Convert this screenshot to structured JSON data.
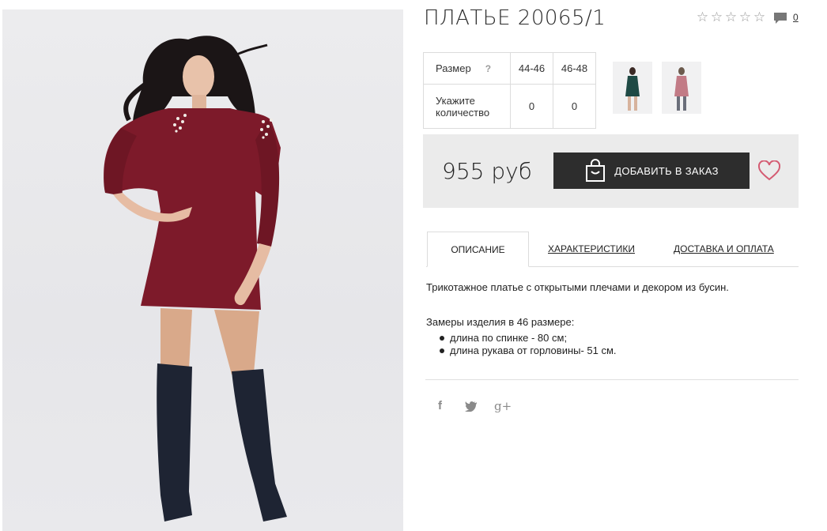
{
  "product": {
    "title": "ПЛАТЬЕ 20065/1",
    "rating_stars": [
      "☆",
      "☆",
      "☆",
      "☆",
      "☆"
    ],
    "comment_count": "0",
    "comment_icon": "speech-bubble-icon"
  },
  "sizes": {
    "size_label": "Размер",
    "help_mark": "?",
    "quantity_label": "Укажите количество",
    "columns": [
      "44-46",
      "46-48"
    ],
    "quantities": [
      "0",
      "0"
    ]
  },
  "thumbnails": [
    {
      "name": "thumbnail-green-dress",
      "color": "#1f4a45"
    },
    {
      "name": "thumbnail-pink-dress",
      "color": "#c27b86"
    }
  ],
  "buy": {
    "price": "955 руб",
    "add_label": "ДОБАВИТЬ В ЗАКАЗ",
    "bag_icon": "shopping-bag-icon",
    "wishlist_icon": "heart-icon"
  },
  "tabs": [
    {
      "label": "ОПИСАНИЕ",
      "active": true
    },
    {
      "label": "ХАРАКТЕРИСТИКИ",
      "active": false
    },
    {
      "label": "ДОСТАВКА И ОПЛАТА",
      "active": false
    }
  ],
  "description": {
    "text": "Трикотажное платье с открытыми плечами и декором из бусин.",
    "measures_title": "Замеры изделия в 46 размере:",
    "measures": [
      "длина по спинке - 80 см;",
      "длина рукава от горловины- 51 см."
    ]
  },
  "share": [
    {
      "name": "facebook-icon",
      "glyph": "f"
    },
    {
      "name": "twitter-icon",
      "glyph": "🐦"
    },
    {
      "name": "google-plus-icon",
      "glyph": "g+"
    }
  ],
  "colors": {
    "dress": "#7d1a2a",
    "boots": "#1e2433",
    "button": "#2d2d2d",
    "heart": "#d45b72"
  }
}
